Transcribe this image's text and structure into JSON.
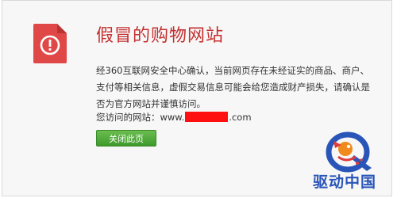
{
  "warning": {
    "title": "假冒的购物网站",
    "body": "经360互联网安全中心确认，当前网页存在未经证实的商品、商户、支付等相关信息，虚假交易信息可能会给您造成财产损失，请确认是否为官方网站并谨慎访问。",
    "url_label": "您访问的网站：",
    "url_prefix": "www.",
    "url_suffix": ".com",
    "icon": "warning-exclamation-icon",
    "close_button_label": "关闭此页"
  },
  "watermark": {
    "text": "驱动中国"
  },
  "colors": {
    "title": "#c52f2f",
    "icon_bg": "#e04848",
    "button": "#4ea83a",
    "redaction": "#ff1010",
    "watermark_text": "#2a55b8"
  }
}
